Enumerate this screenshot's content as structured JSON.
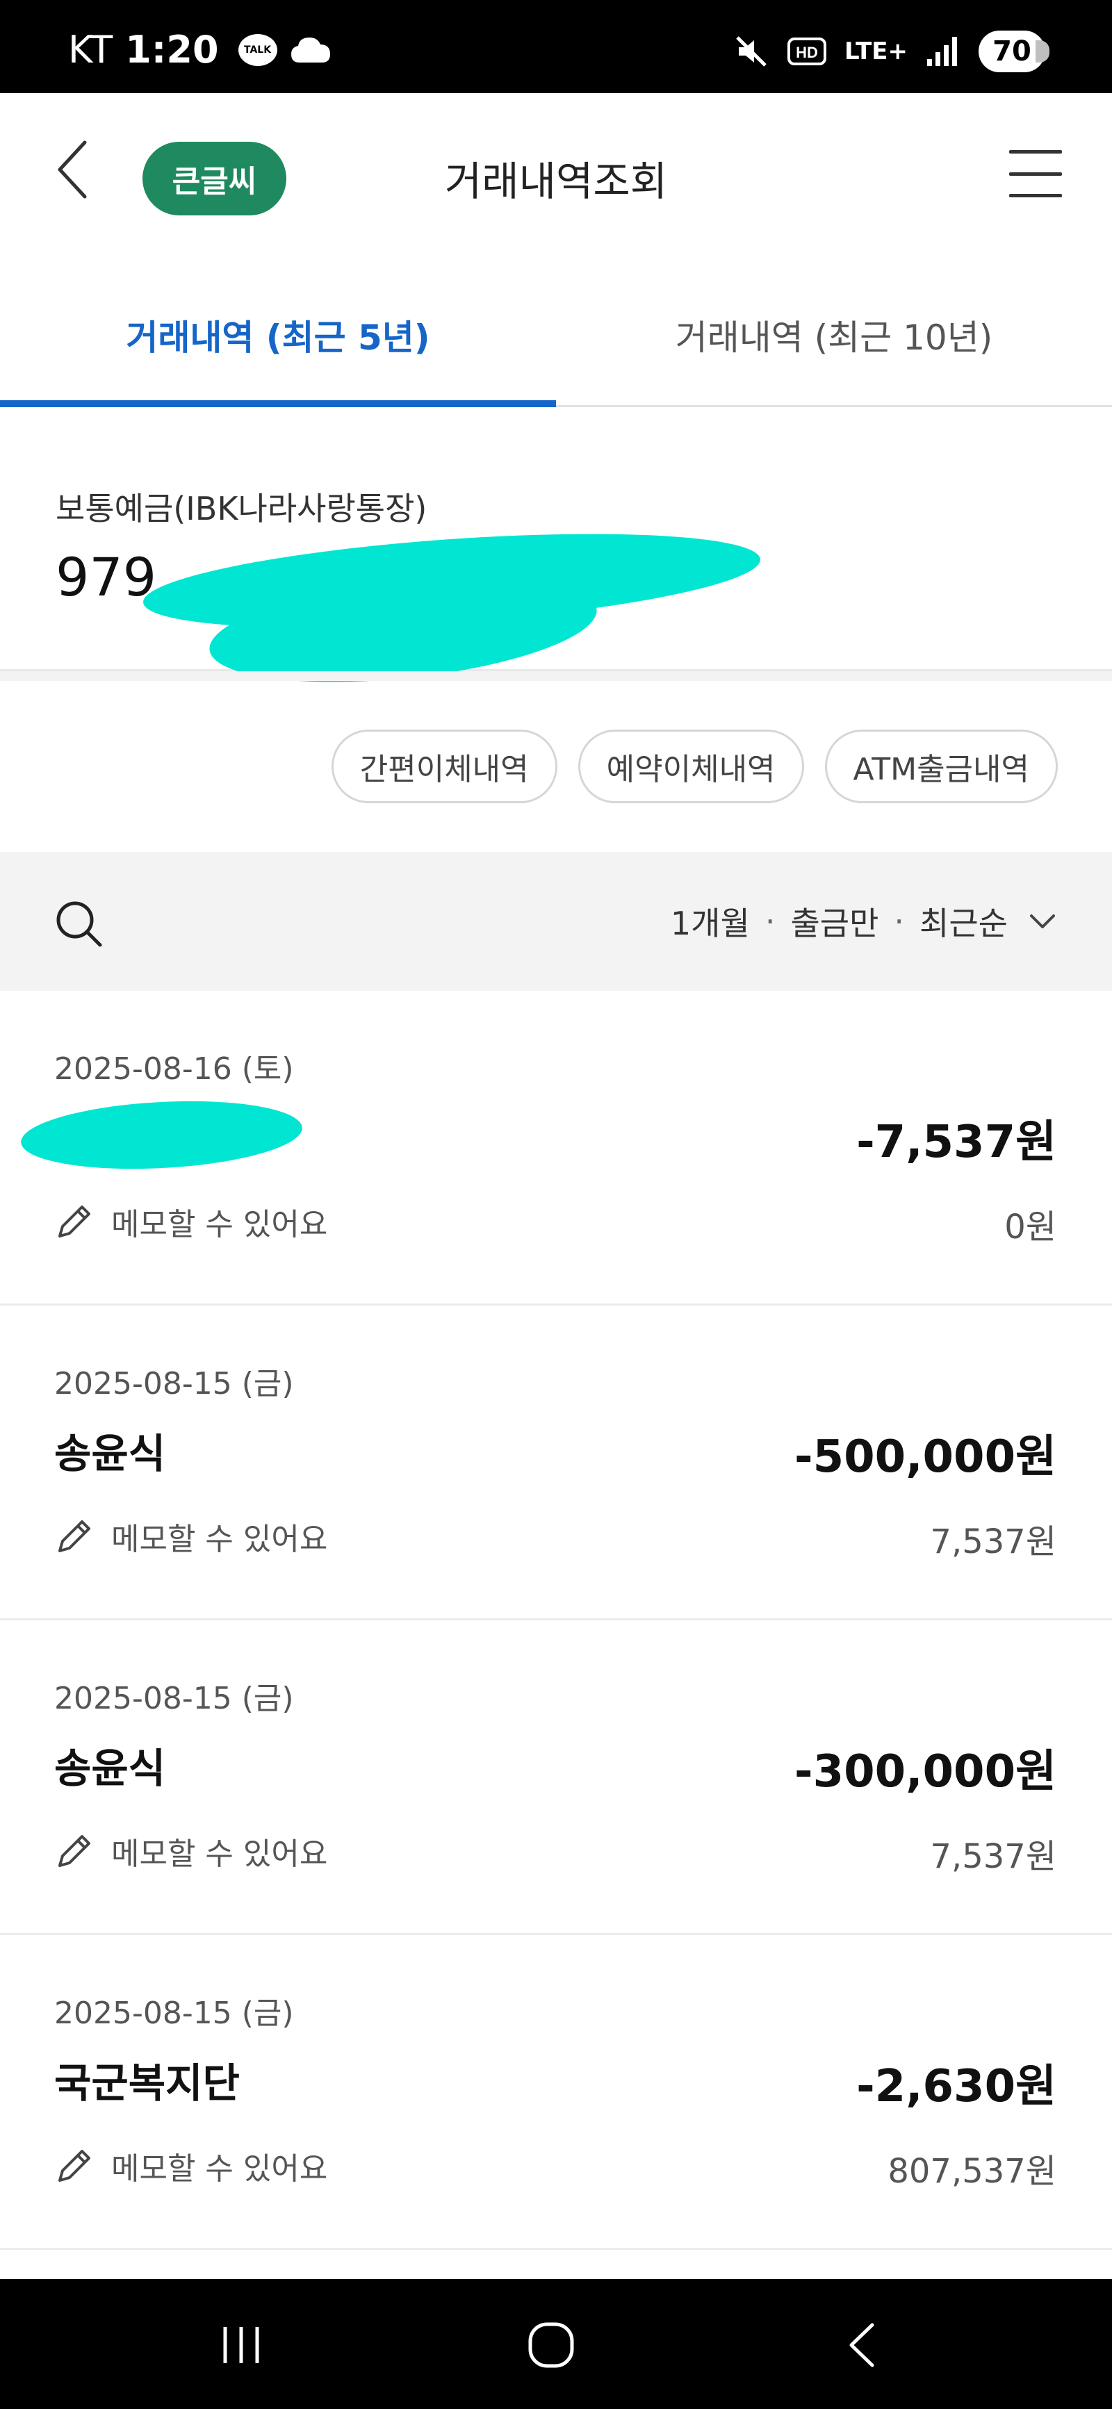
{
  "status_bar": {
    "carrier": "KT",
    "time": "1:20",
    "talk_badge": "TALK",
    "network": "LTE+",
    "battery": "70"
  },
  "header": {
    "big_font_label": "큰글씨",
    "title": "거래내역조회"
  },
  "tabs": [
    {
      "label": "거래내역 (최근 5년)",
      "active": true
    },
    {
      "label": "거래내역 (최근 10년)",
      "active": false
    }
  ],
  "account": {
    "name": "보통예금(IBK나라사랑통장)",
    "number_visible": "979"
  },
  "chips": [
    "간편이체내역",
    "예약이체내역",
    "ATM출금내역"
  ],
  "filter": {
    "period": "1개월",
    "type": "출금만",
    "order": "최근순",
    "separator": "·"
  },
  "transactions": [
    {
      "date": "2025-08-16 (토)",
      "name": "",
      "amount": "-7,537원",
      "memo": "메모할 수 있어요",
      "balance": "0원"
    },
    {
      "date": "2025-08-15 (금)",
      "name": "송윤식",
      "amount": "-500,000원",
      "memo": "메모할 수 있어요",
      "balance": "7,537원"
    },
    {
      "date": "2025-08-15 (금)",
      "name": "송윤식",
      "amount": "-300,000원",
      "memo": "메모할 수 있어요",
      "balance": "7,537원"
    },
    {
      "date": "2025-08-15 (금)",
      "name": "국군복지단",
      "amount": "-2,630원",
      "memo": "메모할 수 있어요",
      "balance": "807,537원"
    }
  ],
  "colors": {
    "accent_blue": "#1665c8",
    "big_font_green": "#1f8a5f",
    "redaction_cyan": "#00e6d2"
  }
}
